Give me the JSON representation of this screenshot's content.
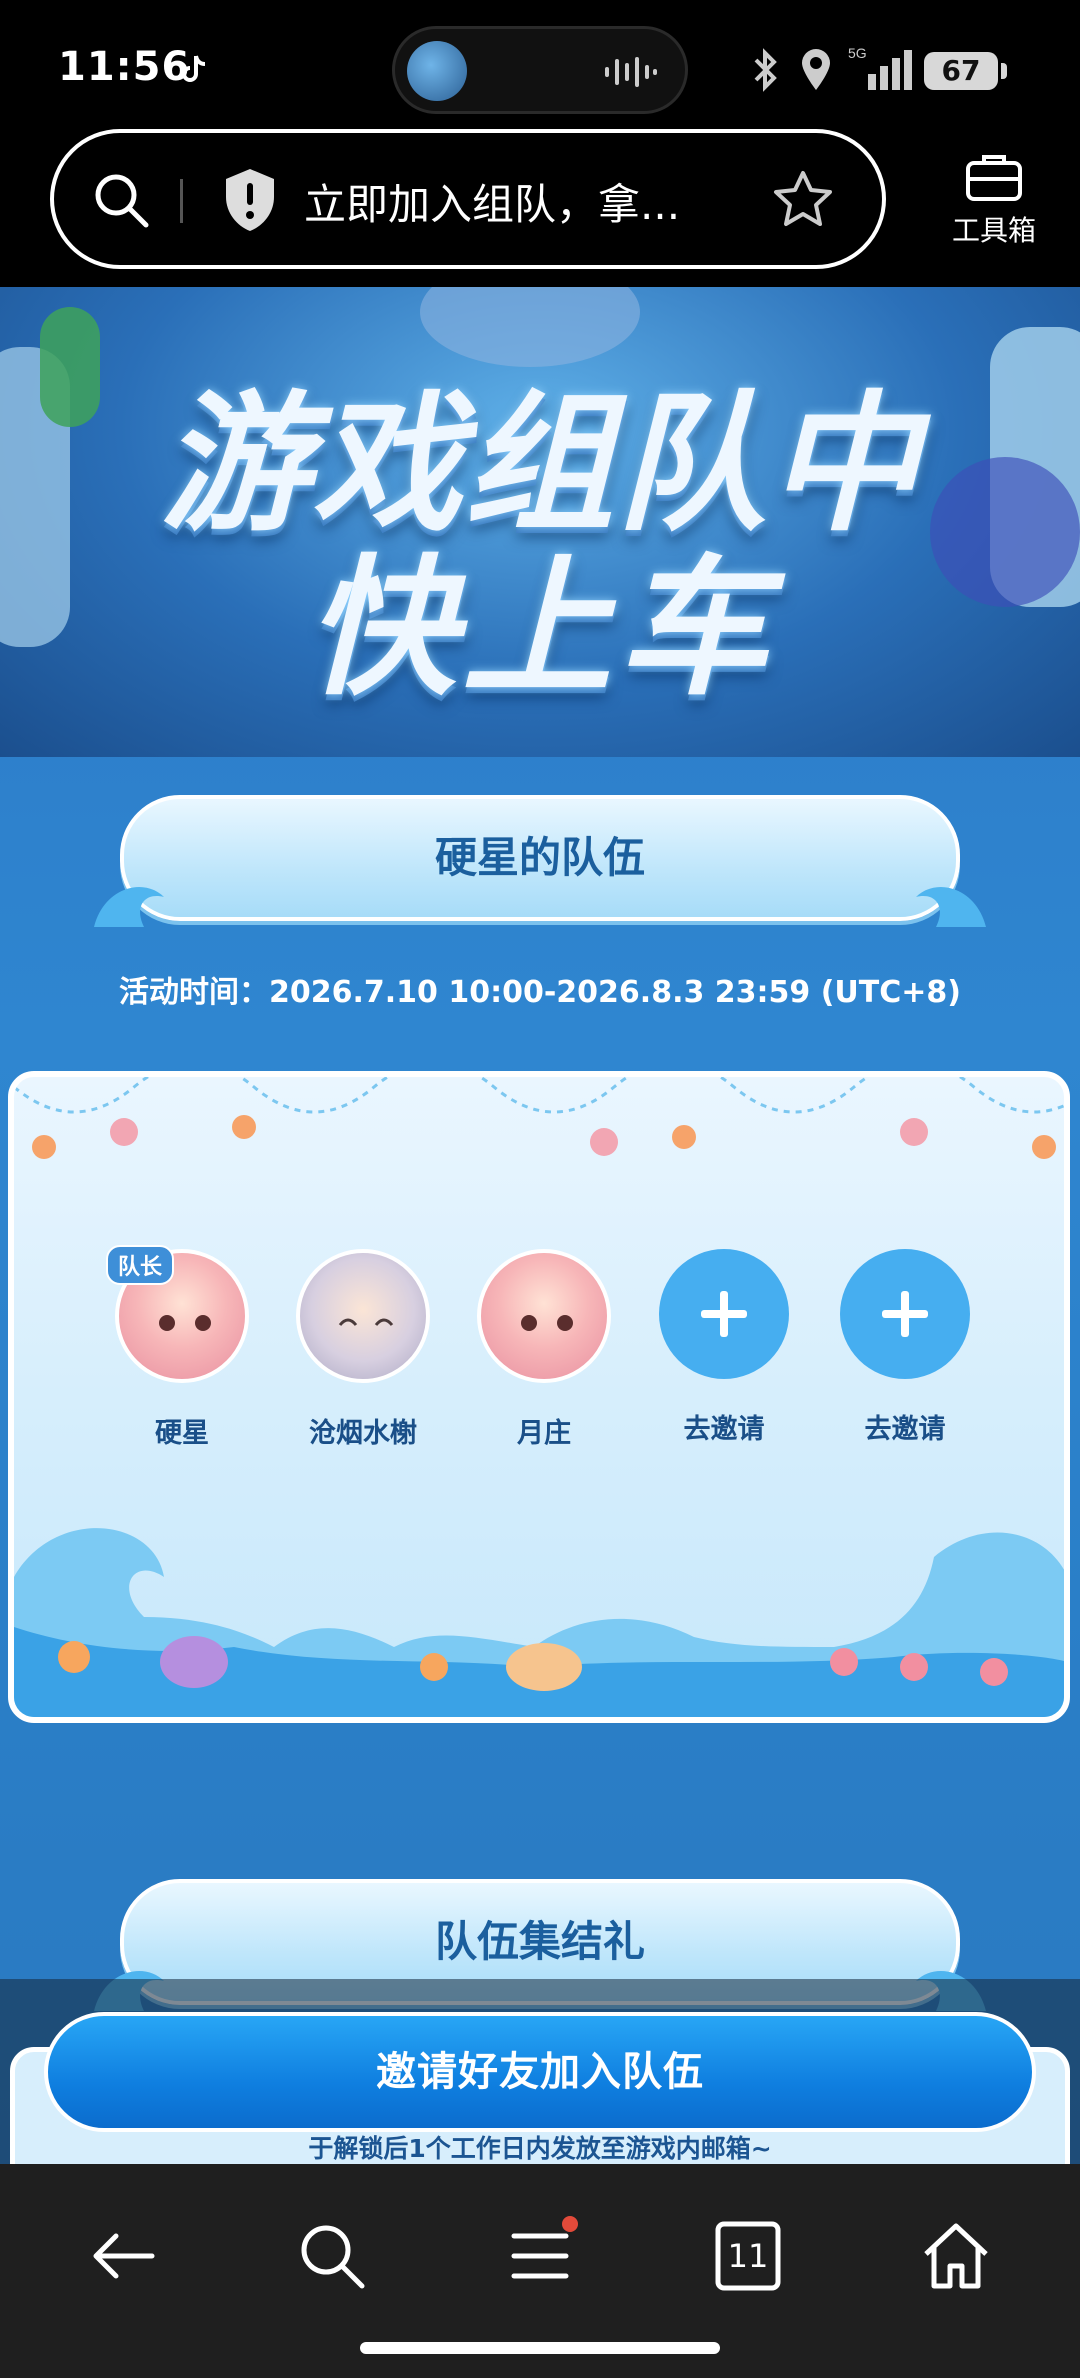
{
  "status_bar": {
    "time": "11:56",
    "battery": "67",
    "network": "5G"
  },
  "browser": {
    "url_text": "立即加入组队，拿...",
    "toolbox_label": "工具箱"
  },
  "hero": {
    "title_line1": "游戏组队中",
    "title_line2": "快上车"
  },
  "team_banner": {
    "title": "硬星的队伍"
  },
  "activity_time": "活动时间：2026.7.10  10:00-2026.8.3  23:59  (UTC+8)",
  "members": [
    {
      "name": "硬星",
      "badge": "队长"
    },
    {
      "name": "沧烟水榭"
    },
    {
      "name": "月庄"
    },
    {
      "name": "去邀请"
    },
    {
      "name": "去邀请"
    }
  ],
  "rally_banner": {
    "title": "队伍集结礼"
  },
  "cta": {
    "label": "邀请好友加入队伍"
  },
  "note": "于解锁后1个工作日内发放至游戏内邮箱~",
  "nav": {
    "tab_count": "11"
  },
  "colors": {
    "accent": "#0f7fe0",
    "page_bg": "#2d7fcb",
    "text_dark_blue": "#1a4f88"
  }
}
